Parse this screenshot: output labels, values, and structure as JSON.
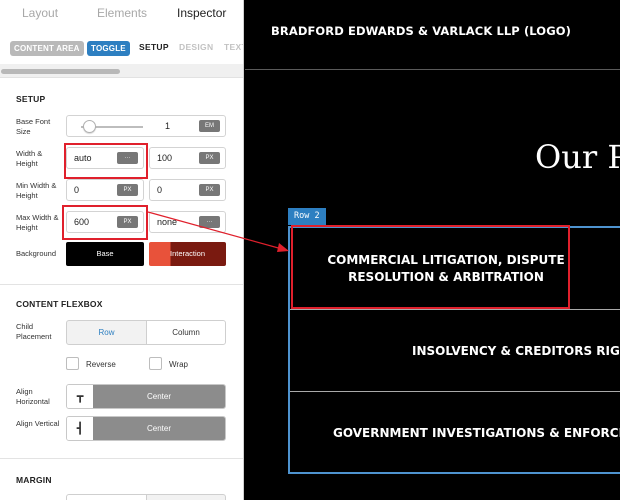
{
  "panel": {
    "top_tabs": [
      "Layout",
      "Elements",
      "Inspector"
    ],
    "sub_tabs": {
      "content_area": "CONTENT AREA",
      "toggle": "TOGGLE",
      "setup": "SETUP",
      "design": "DESIGN",
      "text_partial": "TEXT"
    },
    "setup": {
      "title": "SETUP",
      "base_font_size": {
        "label": "Base Font Size",
        "slider_value": 0.05,
        "value": "1",
        "unit": "EM"
      },
      "width_height": {
        "label": "Width & Height",
        "width": "auto",
        "width_unit": "···",
        "height": "100",
        "height_unit": "PX"
      },
      "min_width_height": {
        "label": "Min Width & Height",
        "width": "0",
        "width_unit": "PX",
        "height": "0",
        "height_unit": "PX"
      },
      "max_width_height": {
        "label": "Max Width & Height",
        "width": "600",
        "width_unit": "PX",
        "height": "none",
        "height_unit": "···"
      },
      "background": {
        "label": "Background",
        "base": "Base",
        "interaction": "Interaction"
      }
    },
    "flexbox": {
      "title": "CONTENT FLEXBOX",
      "child_placement": {
        "label": "Child Placement",
        "row": "Row",
        "column": "Column"
      },
      "reverse": "Reverse",
      "wrap": "Wrap",
      "align_horizontal": {
        "label": "Align Horizontal",
        "value": "Center"
      },
      "align_vertical": {
        "label": "Align Vertical",
        "value": "Center"
      }
    },
    "margin": {
      "title": "MARGIN"
    }
  },
  "canvas": {
    "logo": "BRADFORD EDWARDS & VARLACK LLP (LOGO)",
    "heading": "Our P",
    "row_tag": "Row 2",
    "items": [
      "COMMERCIAL LITIGATION, DISPUTE RESOLUTION & ARBITRATION",
      "INSOLVENCY & CREDITORS RIGH",
      "GOVERNMENT INVESTIGATIONS & ENFORCEN"
    ]
  },
  "colors": {
    "accent_blue": "#2d7fc1",
    "highlight_red": "#e0202c",
    "interaction_orange": "#e8523a",
    "interaction_dark": "#7a1a10",
    "canvas_bg": "#000000"
  }
}
